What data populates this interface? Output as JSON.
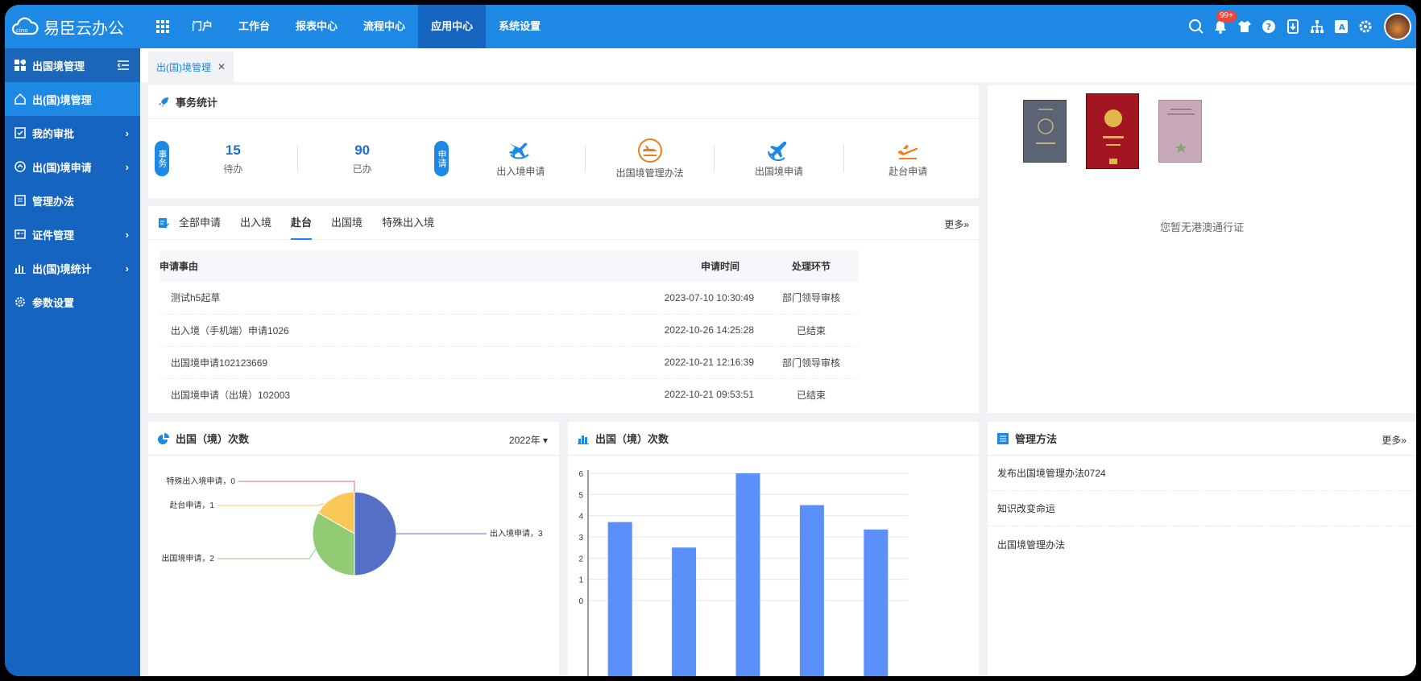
{
  "app": {
    "name": "易臣云办公"
  },
  "nav": {
    "items": [
      "门户",
      "工作台",
      "报表中心",
      "流程中心",
      "应用中心",
      "系统设置"
    ],
    "active_index": 4
  },
  "topbar": {
    "badge": "99+"
  },
  "sidebar": {
    "header": "出国境管理",
    "items": [
      {
        "label": "出(国)境管理",
        "icon": "home-icon",
        "active": true
      },
      {
        "label": "我的审批",
        "icon": "approval-icon",
        "has_children": true
      },
      {
        "label": "出(国)境申请",
        "icon": "apply-icon",
        "has_children": true
      },
      {
        "label": "管理办法",
        "icon": "document-icon"
      },
      {
        "label": "证件管理",
        "icon": "id-card-icon",
        "has_children": true
      },
      {
        "label": "出(国)境统计",
        "icon": "bar-chart-icon",
        "has_children": true
      },
      {
        "label": "参数设置",
        "icon": "gear-icon"
      }
    ]
  },
  "page_tab": {
    "label": "出(国)境管理",
    "close": "✕"
  },
  "stats": {
    "title": "事务统计",
    "affairs_label": "事务",
    "todo": {
      "value": "15",
      "label": "待办"
    },
    "done": {
      "value": "90",
      "label": "已办"
    },
    "apply_label": "申请",
    "apps": [
      {
        "label": "出入境申请",
        "color": "#1e88e5"
      },
      {
        "label": "出国境管理办法",
        "color": "#ef7d1a"
      },
      {
        "label": "出国境申请",
        "color": "#1e88e5"
      },
      {
        "label": "赴台申请",
        "color": "#ef7d1a"
      }
    ]
  },
  "apps_list": {
    "tabs": [
      "全部申请",
      "出入境",
      "赴台",
      "出国境",
      "特殊出入境"
    ],
    "active_tab": 2,
    "more": "更多»",
    "columns": [
      "申请事由",
      "申请时间",
      "处理环节"
    ],
    "rows": [
      [
        "测试h5起草",
        "2023-07-10 10:30:49",
        "部门领导审核"
      ],
      [
        "出入境（手机端）申请1026",
        "2022-10-26 14:25:28",
        "已结束"
      ],
      [
        "出国境申请102123669",
        "2022-10-21 12:16:39",
        "部门领导审核"
      ],
      [
        "出国境申请（出境）102003",
        "2022-10-21 09:53:51",
        "已结束"
      ]
    ]
  },
  "passport": {
    "notice": "您暂无港澳通行证"
  },
  "pie_card": {
    "title": "出国（境）次数",
    "year": "2022年"
  },
  "bar_card": {
    "title": "出国（境）次数"
  },
  "methods": {
    "title": "管理方法",
    "more": "更多»",
    "items": [
      "发布出国境管理办法0724",
      "知识改变命运",
      "出国境管理办法"
    ]
  },
  "chart_data": [
    {
      "type": "pie",
      "labels": [
        "出入境申请",
        "出国境申请",
        "赴台申请",
        "特殊出入境申请"
      ],
      "values": [
        3,
        2,
        1,
        0
      ],
      "colors": [
        "#5470c6",
        "#91cc75",
        "#fac858",
        "#ee6666"
      ],
      "label_texts": [
        "出入境申请，3",
        "出国境申请，2",
        "赴台申请，1",
        "特殊出入境申请，0"
      ]
    },
    {
      "type": "bar",
      "values": [
        3.7,
        2.5,
        6,
        4.5,
        3.35
      ],
      "ylim": [
        0,
        6
      ],
      "yticks": [
        "0",
        "1",
        "2",
        "3",
        "4",
        "5",
        "6"
      ],
      "color": "#5b8ff9"
    }
  ]
}
